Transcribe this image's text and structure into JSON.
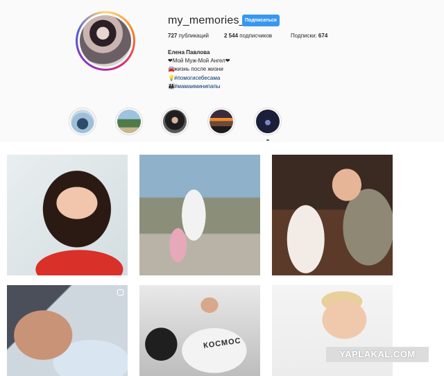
{
  "profile": {
    "username": "my_memories_a",
    "follow_label": "Подписаться",
    "stats": {
      "posts_count": "727",
      "posts_label": "публикаций",
      "followers_count": "2 544",
      "followers_label": "подписчиков",
      "following_label": "Подписки:",
      "following_count": "674"
    },
    "bio": {
      "full_name": "Елена Павлова",
      "line1": "❤Мой Муж-Мой Ангел❤",
      "line2": "жизнь после жизни",
      "line2_icon": "car-icon",
      "line3": "#помогисебесама",
      "line3_icon": "lightbulb-icon",
      "line4": "#мамаиминипапы",
      "line4_icon": "family-icon"
    }
  },
  "highlights": [
    "highlight-1",
    "highlight-2",
    "highlight-3",
    "highlight-4",
    "highlight-5"
  ],
  "posts": {
    "row1": [
      "portrait-woman",
      "mother-daughter-sculpture",
      "father-daughter"
    ],
    "row2": [
      "father-newborn",
      "woman-in-car",
      "toddler-boy"
    ],
    "tile5_text": "КОСМОС"
  },
  "watermark": "YAPLAKAL.COM",
  "colors": {
    "follow_button": "#3897f0",
    "hashtag": "#003569",
    "background": "#fafafa"
  }
}
